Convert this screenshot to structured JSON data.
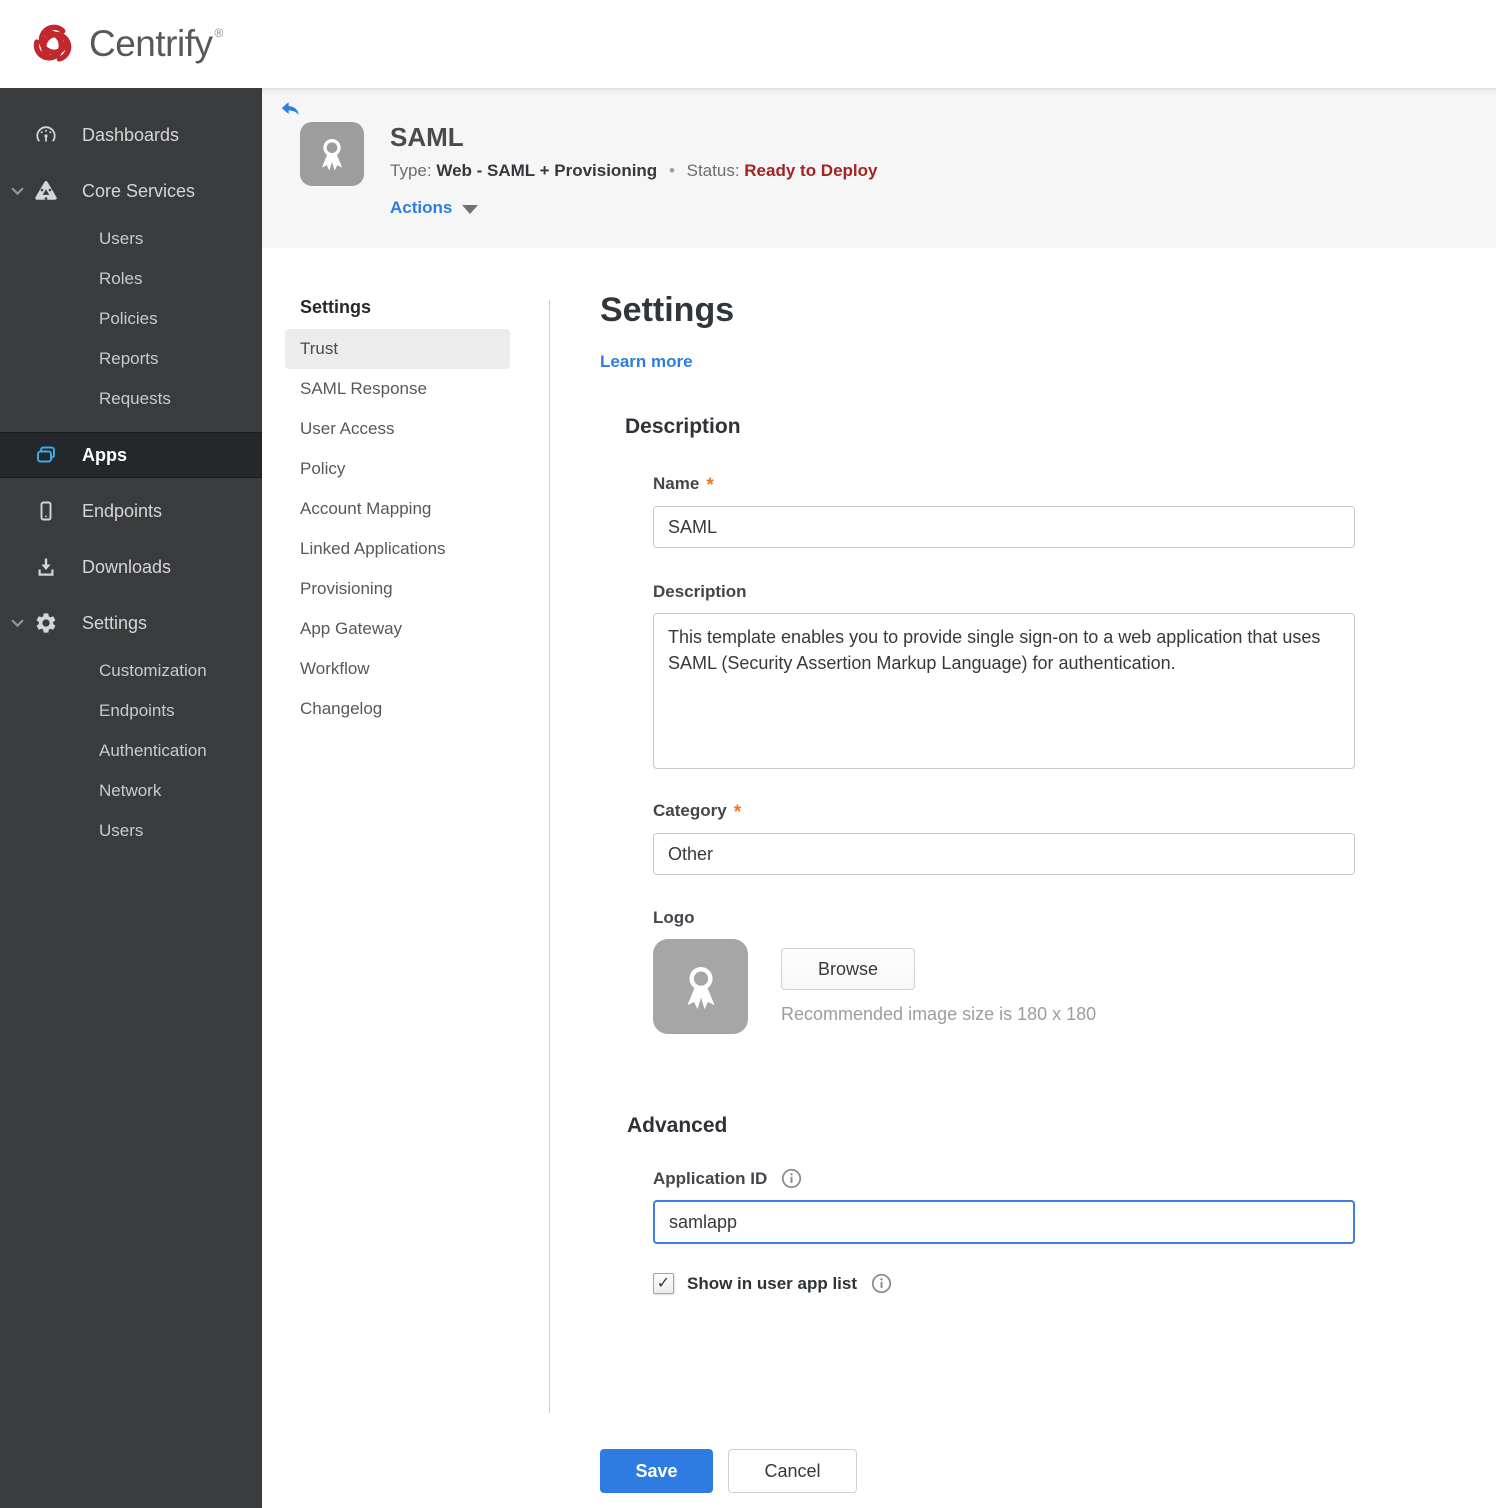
{
  "brand": {
    "name": "Centrify",
    "registered_mark": "®"
  },
  "sidebar": {
    "items": [
      {
        "label": "Dashboards"
      },
      {
        "label": "Core Services",
        "expanded": true,
        "children": [
          "Users",
          "Roles",
          "Policies",
          "Reports",
          "Requests"
        ]
      },
      {
        "label": "Apps",
        "active": true
      },
      {
        "label": "Endpoints"
      },
      {
        "label": "Downloads"
      },
      {
        "label": "Settings",
        "expanded": true,
        "children": [
          "Customization",
          "Endpoints",
          "Authentication",
          "Network",
          "Users"
        ]
      }
    ]
  },
  "header": {
    "app_name": "SAML",
    "type_label": "Type:",
    "type_value": "Web - SAML + Provisioning",
    "separator": "•",
    "status_label": "Status:",
    "status_value": "Ready to Deploy",
    "actions_label": "Actions"
  },
  "subnav": {
    "heading": "Settings",
    "selected": "Trust",
    "items": [
      "Trust",
      "SAML Response",
      "User Access",
      "Policy",
      "Account Mapping",
      "Linked Applications",
      "Provisioning",
      "App Gateway",
      "Workflow",
      "Changelog"
    ]
  },
  "main": {
    "title": "Settings",
    "learn_more_label": "Learn more",
    "required_marker": "*",
    "description_section": {
      "heading": "Description",
      "name_label": "Name",
      "name_value": "SAML",
      "description_label": "Description",
      "description_value": "This template enables you to provide single sign-on to a web application that uses SAML (Security Assertion Markup Language) for authentication.",
      "category_label": "Category",
      "category_value": "Other",
      "logo_label": "Logo",
      "browse_label": "Browse",
      "recommended_text": "Recommended image size is 180 x 180"
    },
    "advanced_section": {
      "heading": "Advanced",
      "application_id_label": "Application ID",
      "application_id_value": "samlapp",
      "show_in_user_app_list_label": "Show in user app list",
      "checkbox_checked": true
    },
    "save_label": "Save",
    "cancel_label": "Cancel"
  },
  "icons": {
    "checkmark": "✓"
  },
  "colors": {
    "accent_blue": "#2e7ce2",
    "link_blue": "#2e7de0",
    "status_red": "#a42422",
    "brand_red": "#c1272d",
    "sidebar_icon_blue": "#3fa9e9",
    "focus_border": "#3e7fe1",
    "sidebar_bg": "#393b3d",
    "header_bg": "#f6f6f7"
  }
}
